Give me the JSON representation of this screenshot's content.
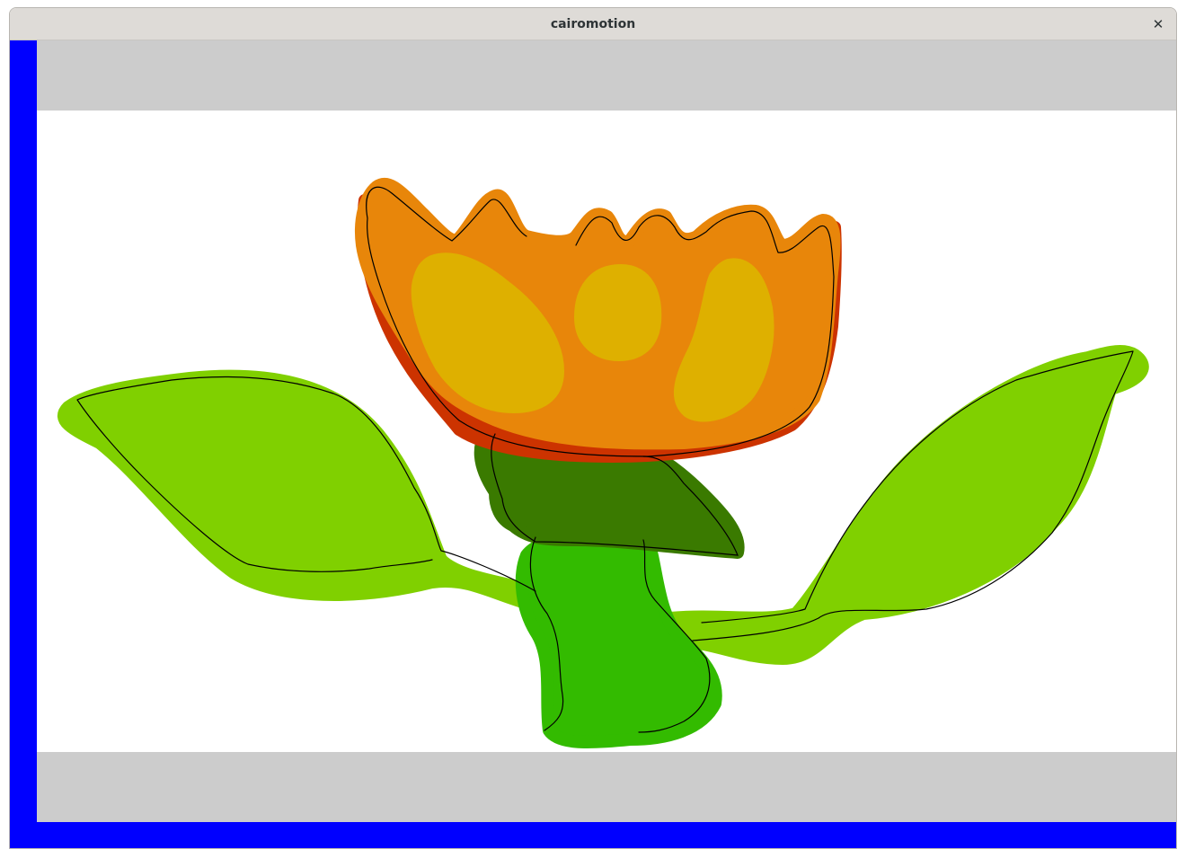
{
  "window": {
    "title": "cairomotion",
    "close_icon": "close-icon",
    "close_glyph": "✕"
  },
  "stage": {
    "frame_color": "#0000ff",
    "letterbox_color": "#cccccc",
    "canvas_color": "#ffffff"
  },
  "drawing": {
    "subject": "flower",
    "colors": {
      "petal_orange": "#e8860a",
      "petal_red": "#cc3300",
      "petal_spots": "#deb000",
      "sepal_dark_green": "#3a7a00",
      "stem_green": "#33bb00",
      "leaf_green": "#80d000",
      "outline": "#000000"
    }
  }
}
